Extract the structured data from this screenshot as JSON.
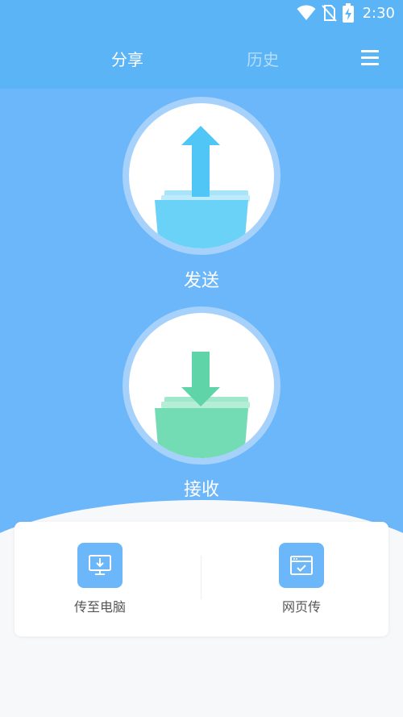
{
  "status_bar": {
    "time": "2:30",
    "icons": [
      "wifi-icon",
      "no-sim-icon",
      "battery-charging-icon"
    ]
  },
  "tabs": {
    "share": "分享",
    "history": "历史"
  },
  "menu_icon": "hamburger-menu-icon",
  "actions": {
    "send": {
      "label": "发送",
      "icon": "upload-tray-icon",
      "color": "#4fc6f5"
    },
    "receive": {
      "label": "接收",
      "icon": "download-tray-icon",
      "color": "#5fd4a8"
    }
  },
  "tools": [
    {
      "label": "传至电脑",
      "icon": "computer-download-icon"
    },
    {
      "label": "网页传",
      "icon": "browser-check-icon"
    }
  ],
  "colors": {
    "primary": "#6cb6fa",
    "appbar": "#5ab4f6",
    "background": "#f7f8fa"
  }
}
